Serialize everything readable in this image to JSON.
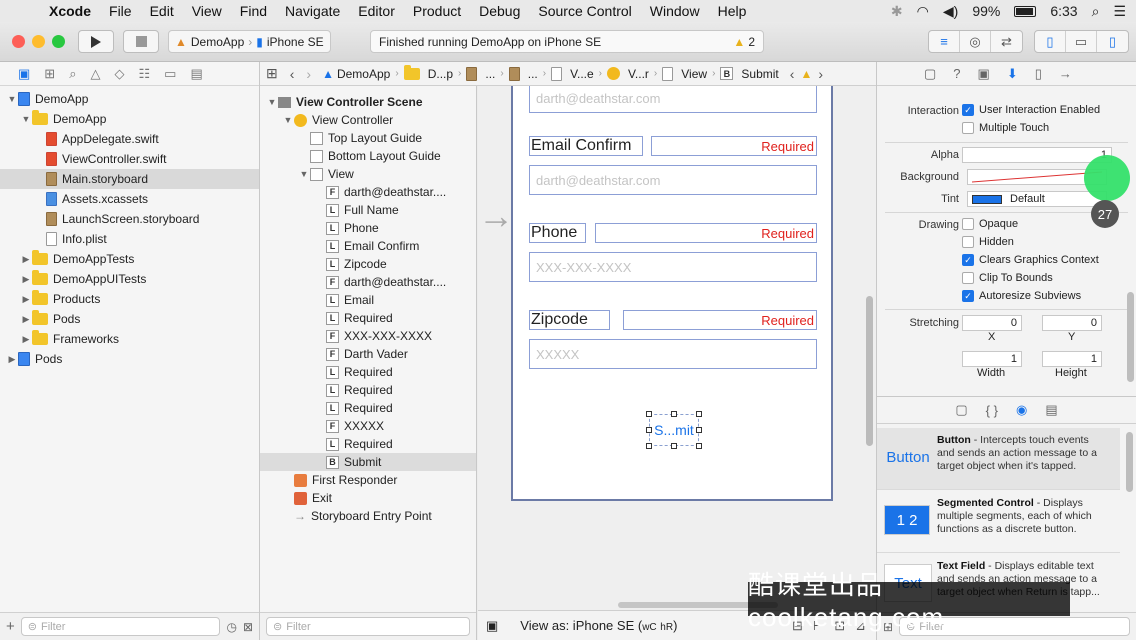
{
  "menubar": {
    "app_name": "Xcode",
    "items": [
      "File",
      "Edit",
      "View",
      "Find",
      "Navigate",
      "Editor",
      "Product",
      "Debug",
      "Source Control",
      "Window",
      "Help"
    ],
    "battery": "99%",
    "time": "6:33"
  },
  "toolbar": {
    "scheme_app": "DemoApp",
    "scheme_device": "iPhone SE",
    "status_text": "Finished running DemoApp on iPhone SE",
    "warning_count": "2"
  },
  "navigator": {
    "items": [
      {
        "label": "DemoApp",
        "indent": 0,
        "disclosure": "▼",
        "icon": "project"
      },
      {
        "label": "DemoApp",
        "indent": 1,
        "disclosure": "▼",
        "icon": "folder"
      },
      {
        "label": "AppDelegate.swift",
        "indent": 2,
        "disclosure": "",
        "icon": "swift"
      },
      {
        "label": "ViewController.swift",
        "indent": 2,
        "disclosure": "",
        "icon": "swift"
      },
      {
        "label": "Main.storyboard",
        "indent": 2,
        "disclosure": "",
        "icon": "storyboard",
        "selected": true
      },
      {
        "label": "Assets.xcassets",
        "indent": 2,
        "disclosure": "",
        "icon": "assets"
      },
      {
        "label": "LaunchScreen.storyboard",
        "indent": 2,
        "disclosure": "",
        "icon": "storyboard"
      },
      {
        "label": "Info.plist",
        "indent": 2,
        "disclosure": "",
        "icon": "file"
      },
      {
        "label": "DemoAppTests",
        "indent": 1,
        "disclosure": "▶",
        "icon": "folder"
      },
      {
        "label": "DemoAppUITests",
        "indent": 1,
        "disclosure": "▶",
        "icon": "folder"
      },
      {
        "label": "Products",
        "indent": 1,
        "disclosure": "▶",
        "icon": "folder"
      },
      {
        "label": "Pods",
        "indent": 1,
        "disclosure": "▶",
        "icon": "folder"
      },
      {
        "label": "Frameworks",
        "indent": 1,
        "disclosure": "▶",
        "icon": "folder"
      },
      {
        "label": "Pods",
        "indent": 0,
        "disclosure": "▶",
        "icon": "project"
      }
    ],
    "filter_placeholder": "Filter"
  },
  "jumpbar": {
    "crumbs": [
      "DemoApp",
      "D...p",
      "...",
      "...",
      "V...e",
      "V...r",
      "View",
      "Submit"
    ]
  },
  "outline": {
    "items": [
      {
        "label": "View Controller Scene",
        "indent": 0,
        "disclosure": "▼",
        "icon": "scene",
        "bold": true
      },
      {
        "label": "View Controller",
        "indent": 1,
        "disclosure": "▼",
        "icon": "vc"
      },
      {
        "label": "Top Layout Guide",
        "indent": 2,
        "disclosure": "",
        "icon": "box"
      },
      {
        "label": "Bottom Layout Guide",
        "indent": 2,
        "disclosure": "",
        "icon": "box"
      },
      {
        "label": "View",
        "indent": 2,
        "disclosure": "▼",
        "icon": "box"
      },
      {
        "label": "darth@deathstar....",
        "indent": 3,
        "disclosure": "",
        "icon": "F"
      },
      {
        "label": "Full Name",
        "indent": 3,
        "disclosure": "",
        "icon": "L"
      },
      {
        "label": "Phone",
        "indent": 3,
        "disclosure": "",
        "icon": "L"
      },
      {
        "label": "Email Confirm",
        "indent": 3,
        "disclosure": "",
        "icon": "L"
      },
      {
        "label": "Zipcode",
        "indent": 3,
        "disclosure": "",
        "icon": "L"
      },
      {
        "label": "darth@deathstar....",
        "indent": 3,
        "disclosure": "",
        "icon": "F"
      },
      {
        "label": "Email",
        "indent": 3,
        "disclosure": "",
        "icon": "L"
      },
      {
        "label": "Required",
        "indent": 3,
        "disclosure": "",
        "icon": "L"
      },
      {
        "label": "XXX-XXX-XXXX",
        "indent": 3,
        "disclosure": "",
        "icon": "F"
      },
      {
        "label": "Darth Vader",
        "indent": 3,
        "disclosure": "",
        "icon": "F"
      },
      {
        "label": "Required",
        "indent": 3,
        "disclosure": "",
        "icon": "L"
      },
      {
        "label": "Required",
        "indent": 3,
        "disclosure": "",
        "icon": "L"
      },
      {
        "label": "Required",
        "indent": 3,
        "disclosure": "",
        "icon": "L"
      },
      {
        "label": "XXXXX",
        "indent": 3,
        "disclosure": "",
        "icon": "F"
      },
      {
        "label": "Required",
        "indent": 3,
        "disclosure": "",
        "icon": "L"
      },
      {
        "label": "Submit",
        "indent": 3,
        "disclosure": "",
        "icon": "B",
        "selected": true
      },
      {
        "label": "First Responder",
        "indent": 1,
        "disclosure": "",
        "icon": "fr"
      },
      {
        "label": "Exit",
        "indent": 1,
        "disclosure": "",
        "icon": "exit"
      },
      {
        "label": "Storyboard Entry Point",
        "indent": 1,
        "disclosure": "",
        "icon": "arrow"
      }
    ],
    "filter_placeholder": "Filter"
  },
  "canvas": {
    "email_placeholder": "darth@deathstar.com",
    "email_confirm_label": "Email Confirm",
    "email_confirm_placeholder": "darth@deathstar.com",
    "phone_label": "Phone",
    "phone_placeholder": "XXX-XXX-XXXX",
    "zipcode_label": "Zipcode",
    "zipcode_placeholder": "XXXXX",
    "required": "Required",
    "submit_label": "S...mit",
    "view_as": "View as: iPhone SE (",
    "size_class_w": "wC",
    "size_class_h": "hR",
    "view_as_close": ")"
  },
  "inspector": {
    "interaction_label": "Interaction",
    "user_interaction": "User Interaction Enabled",
    "multiple_touch": "Multiple Touch",
    "alpha_label": "Alpha",
    "alpha_value": "1",
    "background_label": "Background",
    "tint_label": "Tint",
    "tint_value": "Default",
    "drawing_label": "Drawing",
    "opaque": "Opaque",
    "hidden": "Hidden",
    "clears_graphics": "Clears Graphics Context",
    "clip_to_bounds": "Clip To Bounds",
    "autoresize": "Autoresize Subviews",
    "stretching_label": "Stretching",
    "stretch_x": "0",
    "stretch_y": "0",
    "x_label": "X",
    "y_label": "Y",
    "width_value": "1",
    "height_value": "1",
    "width_label": "Width",
    "height_label": "Height",
    "tint_color": "#1a73e8",
    "badge": "27"
  },
  "library": {
    "items": [
      {
        "icon_text": "Button",
        "title": "Button",
        "desc": " - Intercepts touch events and sends an action message to a target object when it's tapped."
      },
      {
        "icon_text": "1 2",
        "title": "Segmented Control",
        "desc": " - Displays multiple segments, each of which functions as a discrete button."
      },
      {
        "icon_text": "Text",
        "title": "Text Field",
        "desc": " - Displays editable text and sends an action message to a target object when Return is tapp..."
      }
    ],
    "filter_placeholder": "Filter"
  },
  "watermark": "酷课堂出品 coolketang.com",
  "colors": {
    "accent": "#1a73e8",
    "required": "#e0221e",
    "selection_green": "#34e06a"
  }
}
